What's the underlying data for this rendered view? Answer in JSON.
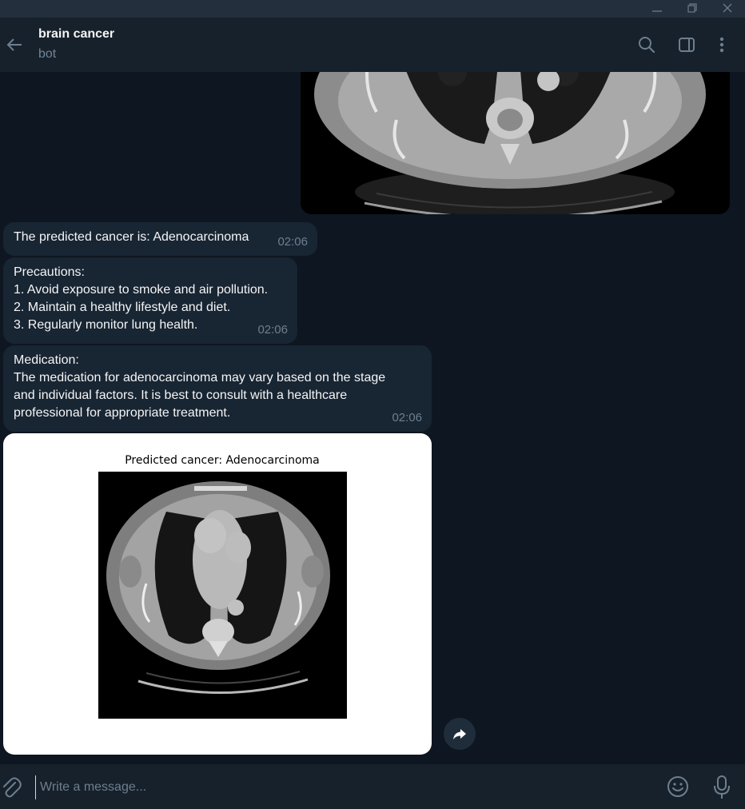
{
  "window": {
    "controls": [
      "minimize-icon",
      "restore-icon",
      "close-icon"
    ]
  },
  "header": {
    "title": "brain cancer",
    "subtitle": "bot",
    "icons": [
      "back-arrow-icon",
      "search-icon",
      "sidebar-toggle-icon",
      "more-vertical-icon"
    ]
  },
  "messages": [
    {
      "lines": [
        "The predicted cancer is: Adenocarcinoma"
      ],
      "time": "02:06"
    },
    {
      "lines": [
        "Precautions:",
        "1. Avoid exposure to smoke and air pollution.",
        "2. Maintain a healthy lifestyle and diet.",
        "3. Regularly monitor lung health."
      ],
      "time": "02:06"
    },
    {
      "lines": [
        "Medication:",
        "The medication for adenocarcinoma may vary based on the stage",
        "and individual factors. It is best to consult with a healthcare",
        "professional for appropriate treatment."
      ],
      "time": "02:06"
    }
  ],
  "result_image": {
    "caption": "Predicted cancer: Adenocarcinoma"
  },
  "composer": {
    "placeholder": "Write a message...",
    "icons": [
      "paperclip-icon",
      "emoji-icon",
      "microphone-icon"
    ]
  },
  "colors": {
    "chat_background": "#0e1621",
    "header_background": "#17212b",
    "bubble_background": "#182533",
    "secondary_text": "#708499"
  }
}
